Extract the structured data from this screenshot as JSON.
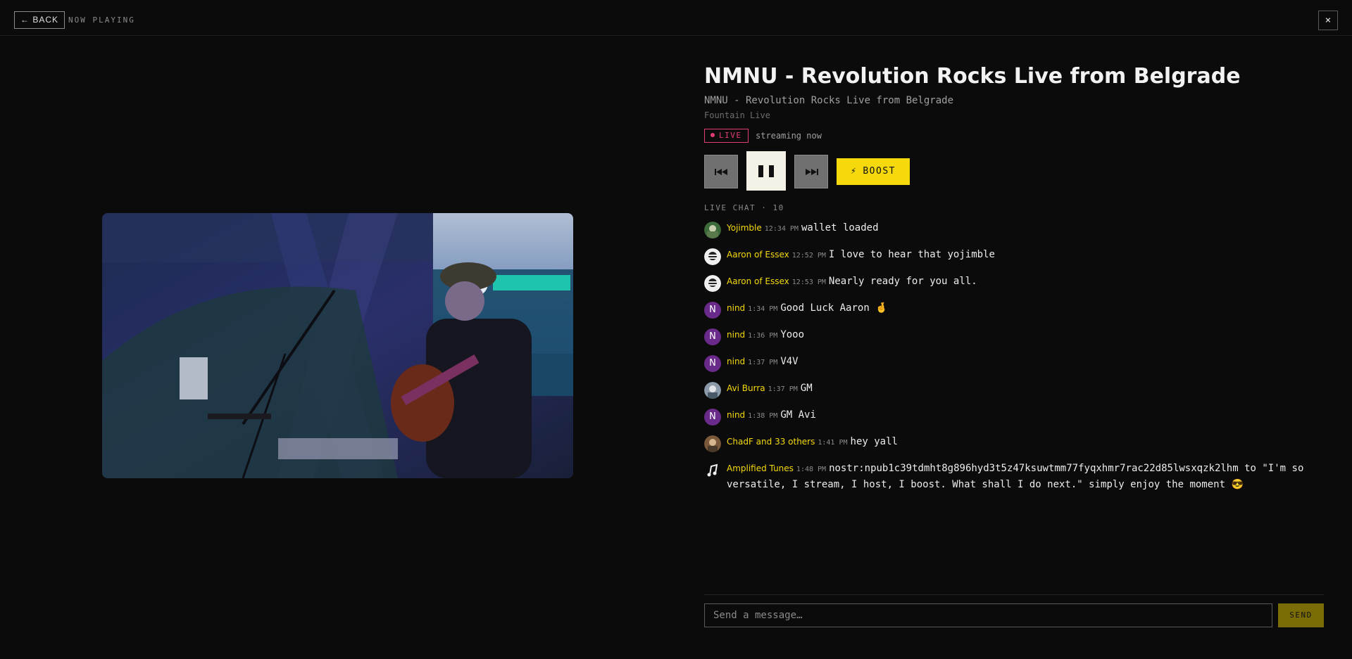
{
  "header": {
    "back_label": "← BACK",
    "section_label": "NOW PLAYING",
    "close_label": "×"
  },
  "track": {
    "title": "NMNU - Revolution Rocks Live from Belgrade",
    "subtitle": "NMNU - Revolution Rocks Live from Belgrade",
    "source": "Fountain Live",
    "live_label": "LIVE",
    "status": "streaming now"
  },
  "controls": {
    "previous_icon": "skip-previous-icon",
    "pause_icon": "pause-icon",
    "next_icon": "skip-next-icon",
    "boost_label": "BOOST",
    "boost_icon": "lightning-icon"
  },
  "chat": {
    "header": "LIVE CHAT · 10",
    "messages": [
      {
        "user": "Yojimble",
        "time": "12:34 PM",
        "text": "wallet loaded",
        "avatar": "photo-avatar"
      },
      {
        "user": "Aaron of Essex",
        "time": "12:52 PM",
        "text": "I love to hear that yojimble",
        "avatar": "photo-avatar"
      },
      {
        "user": "Aaron of Essex",
        "time": "12:53 PM",
        "text": "Nearly ready for you all.",
        "avatar": "photo-avatar"
      },
      {
        "user": "nind",
        "time": "1:34 PM",
        "text": "Good Luck Aaron 🤞",
        "avatar": "N"
      },
      {
        "user": "nind",
        "time": "1:36 PM",
        "text": "Yooo",
        "avatar": "N"
      },
      {
        "user": "nind",
        "time": "1:37 PM",
        "text": "V4V",
        "avatar": "N"
      },
      {
        "user": "Avi Burra",
        "time": "1:37 PM",
        "text": "GM",
        "avatar": "photo-avatar"
      },
      {
        "user": "nind",
        "time": "1:38 PM",
        "text": "GM Avi",
        "avatar": "N"
      },
      {
        "user": "ChadF and 33 others",
        "time": "1:41 PM",
        "text": "hey yall",
        "avatar": "photo-avatar"
      },
      {
        "user": "Amplified Tunes",
        "time": "1:48 PM",
        "text": "nostr:npub1c39tdmht8g896hyd3t5z47ksuwtmm77fyqxhmr7rac22d85lwsxqzk2lhm  to \"I'm so versatile, I stream, I host, I boost. What shall I do next.\" simply enjoy the moment 😎",
        "avatar": "music-note-avatar"
      }
    ]
  },
  "composer": {
    "placeholder": "Send a message…",
    "send_label": "SEND"
  },
  "colors": {
    "accent": "#f5d90a",
    "live": "#e03c78",
    "background": "#0b0b0b"
  }
}
